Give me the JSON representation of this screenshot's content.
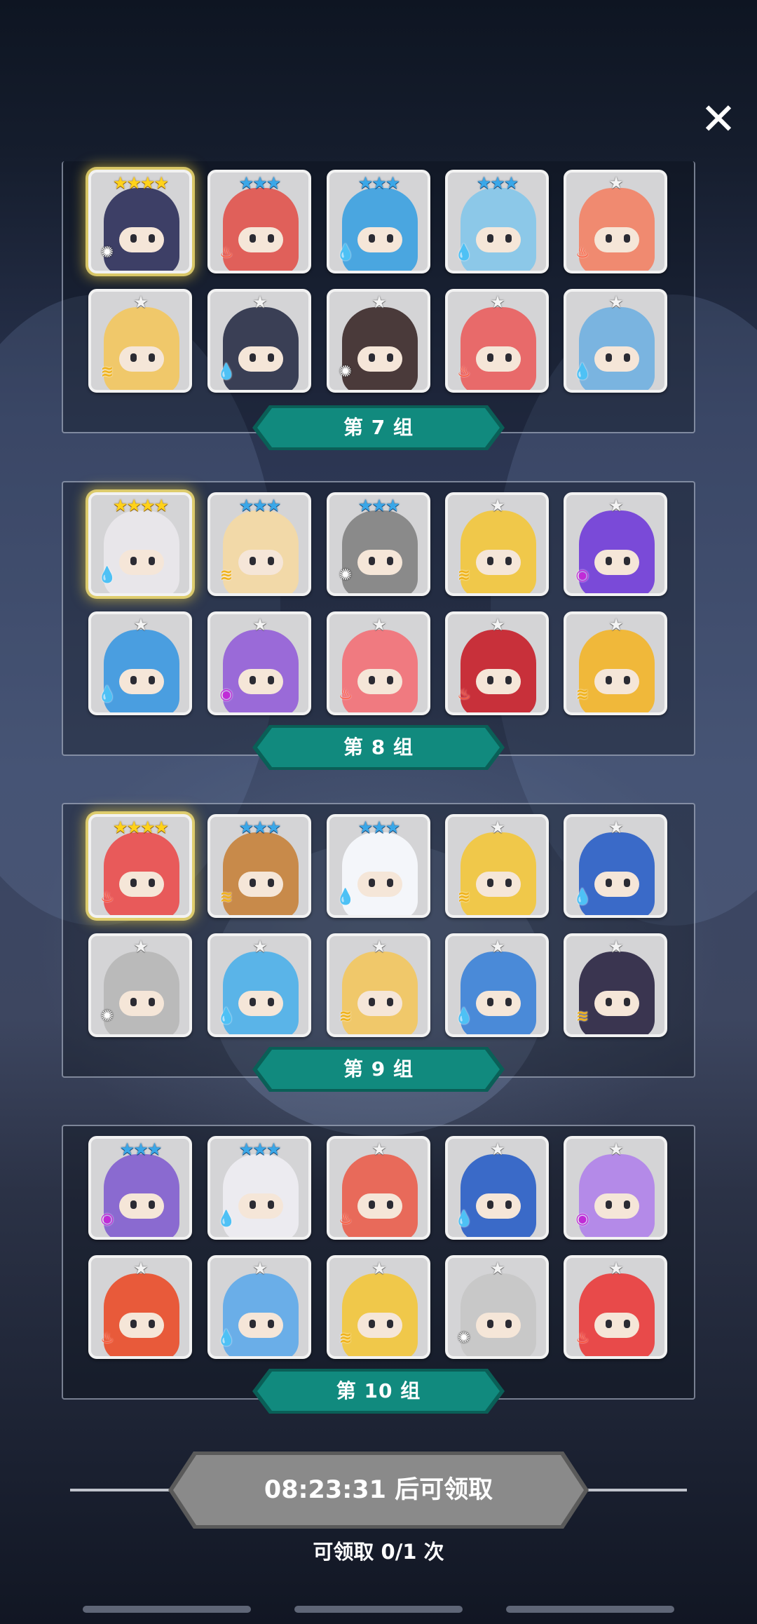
{
  "close_icon": "✕",
  "groups": [
    {
      "label": "第 7 组",
      "cards": [
        {
          "stars": 4,
          "star_color": "gold",
          "element": "light",
          "highlight": true,
          "color": "#3d3f66"
        },
        {
          "stars": 3,
          "star_color": "blue",
          "element": "fire",
          "color": "#e0605a"
        },
        {
          "stars": 3,
          "star_color": "blue",
          "element": "water",
          "color": "#4aa6e0"
        },
        {
          "stars": 3,
          "star_color": "blue",
          "element": "water",
          "color": "#8cc8e8"
        },
        {
          "stars": 1,
          "star_color": "white",
          "element": "fire",
          "color": "#f08a70"
        },
        {
          "stars": 1,
          "star_color": "white",
          "element": "wind",
          "color": "#f0c86a"
        },
        {
          "stars": 1,
          "star_color": "white",
          "element": "water",
          "color": "#3a3f55"
        },
        {
          "stars": 1,
          "star_color": "white",
          "element": "light",
          "color": "#4a3a3a"
        },
        {
          "stars": 1,
          "star_color": "white",
          "element": "fire",
          "color": "#e86a6a"
        },
        {
          "stars": 1,
          "star_color": "white",
          "element": "water",
          "color": "#7ab4e0"
        }
      ]
    },
    {
      "label": "第 8 组",
      "cards": [
        {
          "stars": 4,
          "star_color": "gold",
          "element": "water",
          "highlight": true,
          "color": "#e8e6ea"
        },
        {
          "stars": 3,
          "star_color": "blue",
          "element": "wind",
          "color": "#f2d9a8"
        },
        {
          "stars": 3,
          "star_color": "blue",
          "element": "light",
          "color": "#8a8a8a"
        },
        {
          "stars": 1,
          "star_color": "white",
          "element": "wind",
          "color": "#f0c84a"
        },
        {
          "stars": 1,
          "star_color": "white",
          "element": "dark",
          "color": "#7a4ad8"
        },
        {
          "stars": 1,
          "star_color": "white",
          "element": "water",
          "color": "#4a9ee0"
        },
        {
          "stars": 1,
          "star_color": "white",
          "element": "dark",
          "color": "#9a6ad8"
        },
        {
          "stars": 1,
          "star_color": "white",
          "element": "fire",
          "color": "#f07a80"
        },
        {
          "stars": 1,
          "star_color": "white",
          "element": "fire",
          "color": "#c8303a"
        },
        {
          "stars": 1,
          "star_color": "white",
          "element": "wind",
          "color": "#f0b83a"
        }
      ]
    },
    {
      "label": "第 9 组",
      "cards": [
        {
          "stars": 4,
          "star_color": "gold",
          "element": "fire",
          "highlight": true,
          "color": "#e85a5a"
        },
        {
          "stars": 3,
          "star_color": "blue",
          "element": "wind",
          "color": "#c88a4a"
        },
        {
          "stars": 3,
          "star_color": "blue",
          "element": "water",
          "color": "#f4f6fa"
        },
        {
          "stars": 1,
          "star_color": "white",
          "element": "wind",
          "color": "#f0c84a"
        },
        {
          "stars": 1,
          "star_color": "white",
          "element": "water",
          "color": "#3a6ac8"
        },
        {
          "stars": 1,
          "star_color": "white",
          "element": "light",
          "color": "#bababa"
        },
        {
          "stars": 1,
          "star_color": "white",
          "element": "water",
          "color": "#5ab4e8"
        },
        {
          "stars": 1,
          "star_color": "white",
          "element": "wind",
          "color": "#f0c86a"
        },
        {
          "stars": 1,
          "star_color": "white",
          "element": "water",
          "color": "#4a8ad8"
        },
        {
          "stars": 1,
          "star_color": "white",
          "element": "wind",
          "color": "#3a3550"
        }
      ]
    },
    {
      "label": "第 10 组",
      "cards": [
        {
          "stars": 3,
          "star_color": "blue",
          "element": "dark",
          "color": "#8a6ad0"
        },
        {
          "stars": 3,
          "star_color": "blue",
          "element": "water",
          "color": "#ecebf0"
        },
        {
          "stars": 1,
          "star_color": "white",
          "element": "fire",
          "color": "#e86a5a"
        },
        {
          "stars": 1,
          "star_color": "white",
          "element": "water",
          "color": "#3a6ac8"
        },
        {
          "stars": 1,
          "star_color": "white",
          "element": "dark",
          "color": "#b48ae8"
        },
        {
          "stars": 1,
          "star_color": "white",
          "element": "fire",
          "color": "#e85a3a"
        },
        {
          "stars": 1,
          "star_color": "white",
          "element": "water",
          "color": "#6aaee8"
        },
        {
          "stars": 1,
          "star_color": "white",
          "element": "wind",
          "color": "#f0c84a"
        },
        {
          "stars": 1,
          "star_color": "white",
          "element": "light",
          "color": "#c8c8c8"
        },
        {
          "stars": 1,
          "star_color": "white",
          "element": "fire",
          "color": "#e84a4a"
        }
      ]
    }
  ],
  "element_icons": {
    "light": "✺",
    "fire": "♨",
    "water": "💧",
    "wind": "≋",
    "dark": "◉"
  },
  "claim_button": {
    "label": "08:23:31 后可领取"
  },
  "claim_count": "可领取 0/1 次",
  "colors": {
    "banner": "#118a7e",
    "banner_dark": "#0a5f57",
    "claim_button": "#8a8a8a"
  }
}
